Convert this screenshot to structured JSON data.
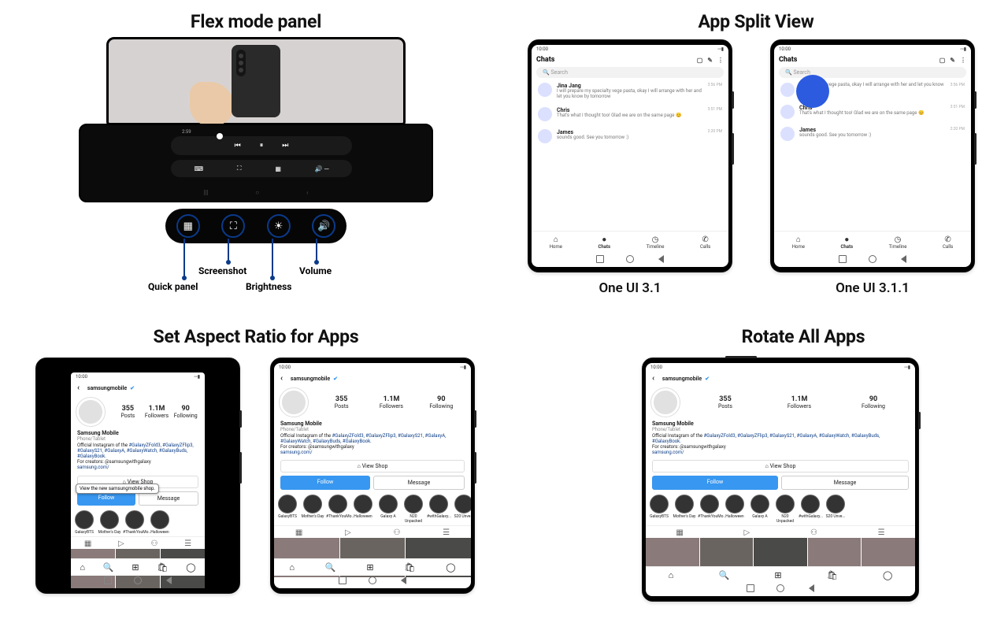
{
  "panel1": {
    "title": "Flex mode panel",
    "media1": {
      "prev": "⏮",
      "play": "⏸",
      "next": "⏭",
      "time": "2:59"
    },
    "media2": {
      "cap": "⌨",
      "pip": "⛶",
      "grid": "▦",
      "vol": "🔊 ─"
    },
    "icons": {
      "quick": {
        "glyph": "▦",
        "label": "Quick panel"
      },
      "shot": {
        "glyph": "⛶",
        "label": "Screenshot"
      },
      "bright": {
        "glyph": "☀",
        "label": "Brightness"
      },
      "volume": {
        "glyph": "🔊",
        "label": "Volume"
      }
    }
  },
  "panel2": {
    "title": "App Split View",
    "left_label": "One UI 3.1",
    "right_label": "One UI 3.1.1",
    "time": "10:00",
    "header": "Chats",
    "search": "Search",
    "chats": [
      {
        "name": "Jina Jang",
        "msg": "I will prepare my specialty vege pasta, okay I will arrange with her and let you know by tomorrow",
        "time": "3:56 PM"
      },
      {
        "name": "Chris",
        "msg": "That's what I thought too! Glad we are on the same page 😊",
        "time": "3:51 PM"
      },
      {
        "name": "James",
        "msg": "sounds good. See you tomorrow :)",
        "time": "2:20 PM"
      }
    ],
    "chats_b": [
      {
        "name": "",
        "msg": "my specialty vege pasta, okay I will arrange with her and let you know by",
        "time": "3:56 PM"
      },
      {
        "name": "Chris",
        "msg": "That's what I thought too! Glad we are on the same page 😊",
        "time": "3:51 PM"
      },
      {
        "name": "James",
        "msg": "sounds good. See you tomorrow :)",
        "time": "2:20 PM"
      }
    ],
    "tabs": [
      {
        "icon": "⌂",
        "label": "Home"
      },
      {
        "icon": "●",
        "label": "Chats"
      },
      {
        "icon": "◷",
        "label": "Timeline"
      },
      {
        "icon": "✆",
        "label": "Calls"
      }
    ]
  },
  "panel3": {
    "title": "Set Aspect Ratio for Apps",
    "tooltip": "View the new samsungmobile shop."
  },
  "panel4": {
    "title": "Rotate All Apps"
  },
  "ig": {
    "handle": "samsungmobile",
    "verified": "✔",
    "posts": "355",
    "posts_l": "Posts",
    "followers": "1.1M",
    "followers_l": "Followers",
    "following": "90",
    "following_l": "Following",
    "name": "Samsung Mobile",
    "cat": "Phone/Tablet",
    "bio1": "Official Instagram of the ",
    "hashtags": "#GalaxyZFold3, #GalaxyZFlip3, #GalaxyS21, #GalaxyA, #GalaxyWatch, #GalaxyBuds, #GalaxyBook.",
    "bio2": "For creators: @samsungwithgalaxy",
    "link": "samsung.com/",
    "shop": "⌂ View Shop",
    "follow": "Follow",
    "message": "Message",
    "highlights": [
      "GalaxyBTS",
      "Mother's Day",
      "#ThankYouMo...",
      "Halloween",
      "Galaxy A",
      "N20 Unpacked",
      "#withGalaxy...",
      "S20 Unve..."
    ],
    "tab_icons": [
      "▦",
      "▷",
      "⚇",
      "☰"
    ],
    "nav_icons": [
      "⌂",
      "🔍",
      "⊞",
      "🛍",
      "◯"
    ]
  }
}
